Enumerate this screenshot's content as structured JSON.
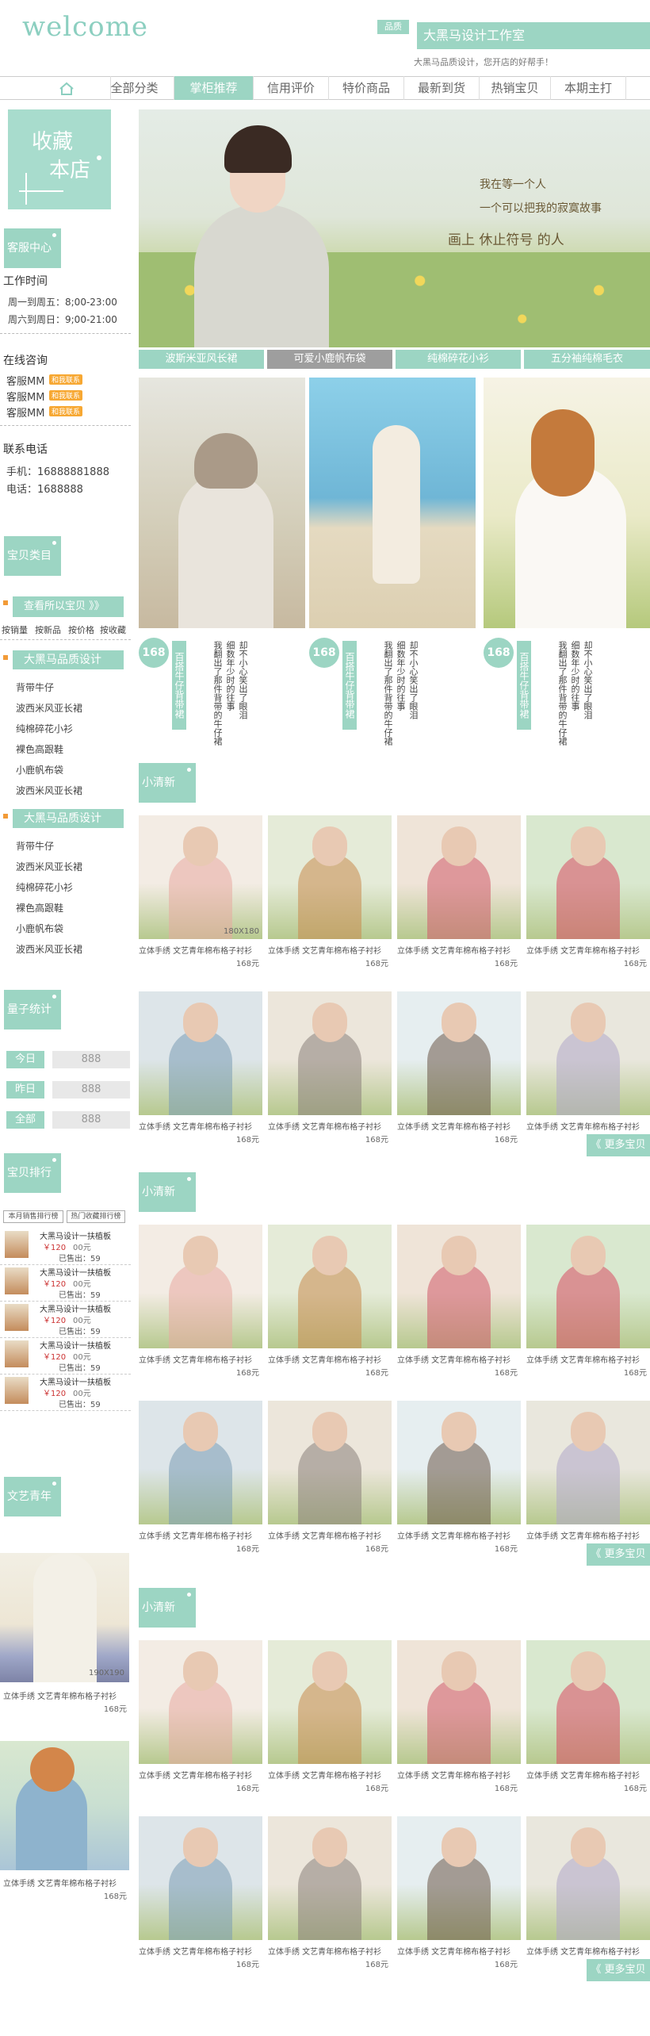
{
  "header": {
    "logo": "welcome",
    "shop_badge": "品质",
    "shop_name": "大黑马设计工作室",
    "shop_slogan": "大黑马品质设计，您开店的好帮手！"
  },
  "nav": {
    "home_icon": "home-icon",
    "items": [
      "全部分类",
      "掌柜推荐",
      "信用评价",
      "特价商品",
      "最新到货",
      "热销宝贝",
      "本期主打"
    ]
  },
  "sidebar": {
    "collect": {
      "line1": "收藏",
      "line2": "本店"
    },
    "service_center": "客服中心",
    "work_time_title": "工作时间",
    "work_times": [
      "周一到周五：8;00-23:00",
      "周六到周日：9;00-21:00"
    ],
    "online_title": "在线咨询",
    "online_items": [
      "客服MM",
      "客服MM",
      "客服MM"
    ],
    "online_badge": "和我联系",
    "phone_title": "联系电话",
    "phone_mobile": "手机：16888881888",
    "phone_tel": "电话：1688888",
    "category_tab": "宝贝类目",
    "view_all": "查看所以宝贝 》》",
    "sort_links": [
      "按销量",
      "按新品",
      "按价格",
      "按收藏"
    ],
    "group1_title": "大黑马品质设计",
    "group1_items": [
      "背带牛仔",
      "波西米风亚长裙",
      "纯棉碎花小衫",
      "裸色高跟鞋",
      "小鹿帆布袋",
      "波西米风亚长裙"
    ],
    "group2_title": "大黑马品质设计",
    "group2_items": [
      "背带牛仔",
      "波西米风亚长裙",
      "纯棉碎花小衫",
      "裸色高跟鞋",
      "小鹿帆布袋",
      "波西米风亚长裙"
    ],
    "stats_tab": "量子统计",
    "stats": [
      {
        "label": "今日",
        "value": "888"
      },
      {
        "label": "昨日",
        "value": "888"
      },
      {
        "label": "全部",
        "value": "888"
      }
    ],
    "rank_tab": "宝贝排行榜",
    "rank_tabs": [
      "本月销售排行榜",
      "热门收藏排行榜"
    ],
    "rank_items": [
      {
        "name": "大黑马设计一扶植板",
        "price": "￥120",
        "orig": "00元",
        "sold": "已售出：59"
      },
      {
        "name": "大黑马设计一扶植板",
        "price": "￥120",
        "orig": "00元",
        "sold": "已售出：59"
      },
      {
        "name": "大黑马设计一扶植板",
        "price": "￥120",
        "orig": "00元",
        "sold": "已售出：59"
      },
      {
        "name": "大黑马设计一扶植板",
        "price": "￥120",
        "orig": "00元",
        "sold": "已售出：59"
      },
      {
        "name": "大黑马设计一扶植板",
        "price": "￥120",
        "orig": "00元",
        "sold": "已售出：59"
      }
    ],
    "youth_tab": "文艺青年",
    "youth_items": [
      {
        "caption": "立体手绣 文艺青年棉布格子衬衫",
        "price": "168元",
        "size": "190X190"
      },
      {
        "caption": "立体手绣 文艺青年棉布格子衬衫",
        "price": "168元"
      }
    ]
  },
  "banner": {
    "text1": "我在等一个人",
    "text2": "一个可以把我的寂寞故事",
    "text3": "画上  休止符号  的人",
    "tabs": [
      "波斯米亚风长裙",
      "可爱小鹿帆布袋",
      "纯棉碎花小衫",
      "五分袖纯棉毛衣"
    ]
  },
  "featured": {
    "items": [
      {
        "price": "168",
        "badge": "百搭牛仔背带裙",
        "desc": [
          "我翻出了那件背带的牛仔裙",
          "细数年少时的往事",
          "却不小心笑出了眼泪"
        ]
      },
      {
        "price": "168",
        "badge": "百搭牛仔背带裙",
        "desc": [
          "我翻出了那件背带的牛仔裙",
          "细数年少时的往事",
          "却不小心笑出了眼泪"
        ]
      },
      {
        "price": "168",
        "badge": "百搭牛仔背带裙",
        "desc": [
          "我翻出了那件背带的牛仔裙",
          "细数年少时的往事",
          "却不小心笑出了眼泪"
        ]
      }
    ]
  },
  "sections": [
    {
      "title": "小清新",
      "size_label": "180X180",
      "more": "《 更多宝贝"
    },
    {
      "title": "小清新",
      "more": "《 更多宝贝"
    },
    {
      "title": "小清新",
      "more": "《 更多宝贝"
    }
  ],
  "product": {
    "caption": "立体手绣 文艺青年棉布格子衬衫",
    "price": "168元"
  },
  "colors": {
    "accent": "#9cd5c3",
    "accent_text": "#ffffff"
  }
}
